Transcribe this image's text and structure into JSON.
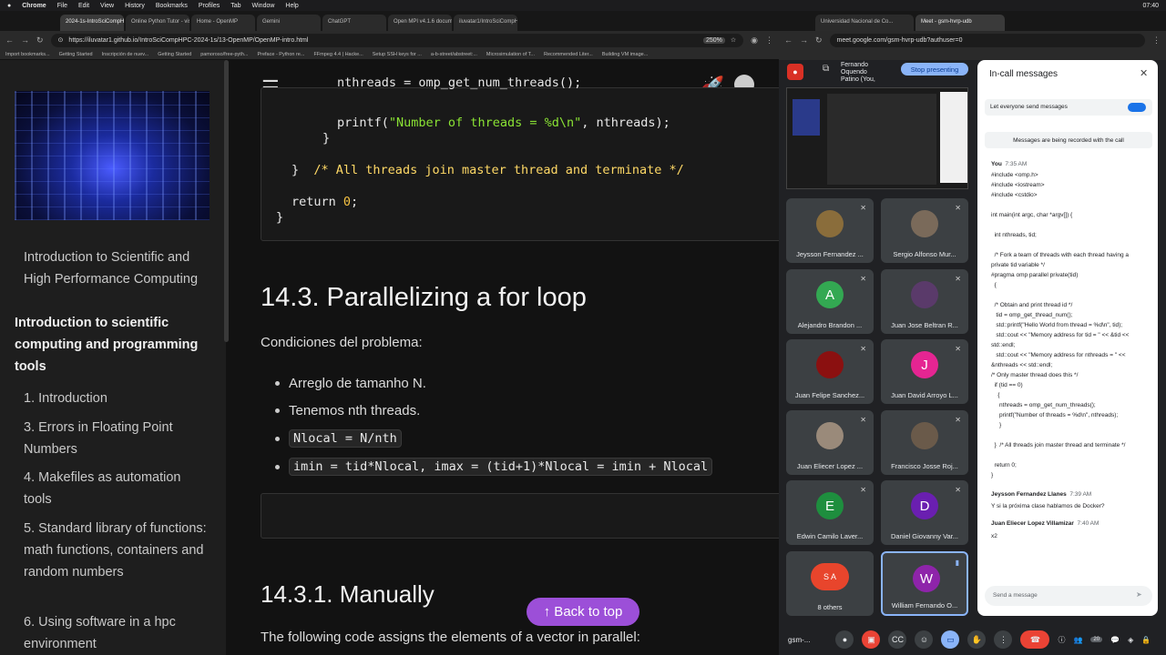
{
  "menubar": {
    "apple": "",
    "app": "Chrome",
    "items": [
      "File",
      "Edit",
      "View",
      "History",
      "Bookmarks",
      "Profiles",
      "Tab",
      "Window",
      "Help"
    ],
    "clock": "07:40"
  },
  "left_browser": {
    "tabs": [
      "2024-1s-IntroSciCompHPC",
      "Online Python Tutor - visualize",
      "Home - OpenMP",
      "Gemini",
      "ChatGPT",
      "Open MPI v4.1.6 documentation",
      "iluvatar1/IntroSciCompHPC-2024"
    ],
    "url": "https://iluvatar1.github.io/IntroSciCompHPC-2024-1s/13-OpenMP/OpenMP-intro.html",
    "zoom": "250%",
    "bookmarks": [
      "Import bookmarks...",
      "Getting Started",
      "Inscripción de nuev...",
      "Getting Started",
      "pamoroso/free-pyth...",
      "Preface - Python re...",
      "FFmpeg 4.4 | Hacke...",
      "Setup SSH keys for ...",
      "a-b-street/abstreet:...",
      "Microsimulation of T...",
      "Recommended Liter...",
      "Building VM image..."
    ]
  },
  "sidebar": {
    "book_title": "Introduction to Scientific and High Performance Computing",
    "part_title": "Introduction to scientific computing and programming tools",
    "items": [
      "1. Introduction",
      "3. Errors in Floating Point Numbers",
      "4. Makefiles as automation tools",
      "5. Standard library of functions: math functions, containers and random numbers",
      "6. Using software in a hpc environment"
    ]
  },
  "content": {
    "code_lines": {
      "l1": "nthreads = omp_get_num_threads();",
      "l2a": "printf(",
      "l2s": "\"Number of threads = %d\\n\"",
      "l2b": ", nthreads);",
      "l3": "}",
      "l4a": "}",
      "l4c": "/* All threads join master thread and terminate */",
      "l5a": "return ",
      "l5n": "0",
      "l5b": ";",
      "l6": "}"
    },
    "section_title": "14.3. Parallelizing a for loop",
    "conditions": "Condiciones del problema:",
    "bullets": [
      "Arreglo de tamanho N.",
      "Tenemos nth threads.",
      "Nlocal = N/nth",
      "imin = tid*Nlocal, imax = (tid+1)*Nlocal = imin + Nlocal"
    ],
    "subsection_title": "14.3.1. Manually",
    "para": "The following code assigns the elements of a vector in parallel:",
    "back_to_top": "↑ Back to top"
  },
  "right_browser": {
    "tabs": [
      "Universidad Nacional de Co...",
      "Meet - gsm-hvrp-udb"
    ],
    "url": "meet.google.com/gsm-hvrp-udb?authuser=0",
    "presenter": "Fernando Oquendo Patino (You,",
    "stop_presenting": "Stop presenting",
    "participants": [
      {
        "name": "Jeysson Fernandez ...",
        "initial": "",
        "color": "#8a6d3b"
      },
      {
        "name": "Sergio Alfonso Mur...",
        "initial": "",
        "color": "#7a6a5a"
      },
      {
        "name": "Alejandro Brandon ...",
        "initial": "A",
        "color": "#33a852"
      },
      {
        "name": "Juan Jose Beltran R...",
        "initial": "",
        "color": "#5a3a6a"
      },
      {
        "name": "Juan Felipe Sanchez...",
        "initial": "",
        "color": "#8b1010"
      },
      {
        "name": "Juan David Arroyo L...",
        "initial": "J",
        "color": "#e52592"
      },
      {
        "name": "Juan Eliecer Lopez ...",
        "initial": "",
        "color": "#9a8a7a"
      },
      {
        "name": "Francisco Josse Roj...",
        "initial": "",
        "color": "#6a5a4a"
      },
      {
        "name": "Edwin Camilo Laver...",
        "initial": "E",
        "color": "#1e8e3e"
      },
      {
        "name": "Daniel Giovanny Var...",
        "initial": "D",
        "color": "#6a1fb0"
      },
      {
        "name": "8 others",
        "initial": "S A",
        "color": "#e8452c"
      },
      {
        "name": "William Fernando O...",
        "initial": "W",
        "color": "#8e24aa"
      }
    ],
    "chat": {
      "title": "In-call messages",
      "toggle_label": "Let everyone send messages",
      "recorded": "Messages are being recorded with the call",
      "me": "You",
      "me_time": "7:35 AM",
      "code_msg": "#include <omp.h>\n#include <iostream>\n#include <cstdio>\n\nint main(int argc, char *argv[]) {\n\n  int nthreads, tid;\n\n  /* Fork a team of threads with each thread having a\nprivate tid variable */\n#pragma omp parallel private(tid)\n  {\n\n  /* Obtain and print thread id */\n   tid = omp_get_thread_num();\n   std::printf(\"Hello World from thread = %d\\n\", tid);\n   std::cout << \"Memory address for tid = \" << &tid <<\nstd::endl;\n   std::cout << \"Memory address for nthreads = \" <<\n&nthreads << std::endl;\n/* Only master thread does this */\n  if (tid == 0)\n    {\n     nthreads = omp_get_num_threads();\n     printf(\"Number of threads = %d\\n\", nthreads);\n     }\n\n  }  /* All threads join master thread and terminate */\n\n  return 0;\n}",
      "m2_name": "Jeysson Fernandez Llanes",
      "m2_time": "7:39 AM",
      "m2_text": "Y si la próxima clase hablamos de Docker?",
      "m3_name": "Juan Eliecer Lopez Villamizar",
      "m3_time": "7:40 AM",
      "m3_text": "x2",
      "input_placeholder": "Send a message"
    },
    "meeting_code": "gsm-...",
    "participant_count": "20"
  }
}
